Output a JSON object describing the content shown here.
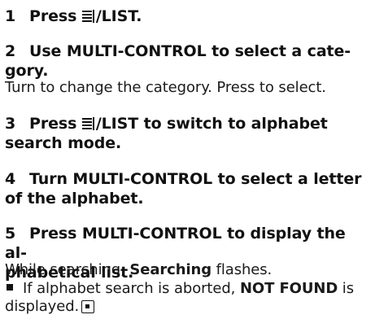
{
  "steps": [
    {
      "num": "1",
      "pre": "Press ",
      "post": "/LIST."
    },
    {
      "num": "2",
      "line1": "Use MULTI-CONTROL to select a cate-",
      "line2": "gory."
    },
    {
      "num": "3",
      "pre": "Press ",
      "post": "/LIST to switch to alphabet",
      "line2": "search mode."
    },
    {
      "num": "4",
      "line1": "Turn MULTI-CONTROL to select a letter",
      "line2": "of the alphabet."
    },
    {
      "num": "5",
      "line1": "Press MULTI-CONTROL to display the al-",
      "line2": "phabetical list."
    }
  ],
  "texts": {
    "step2_body": "Turn to change the category. Press to select.",
    "step5_body_pre": "While searching, ",
    "step5_body_bold": "Searching",
    "step5_body_post": " flashes.",
    "note_pre": "If alphabet search is aborted, ",
    "note_bold": "NOT FOUND",
    "note_mid": " is",
    "note_line2": "displayed."
  },
  "icons": {
    "list_button": "list-button-icon",
    "bullet": "square-bullet-icon",
    "end_mark": "section-end-icon"
  }
}
